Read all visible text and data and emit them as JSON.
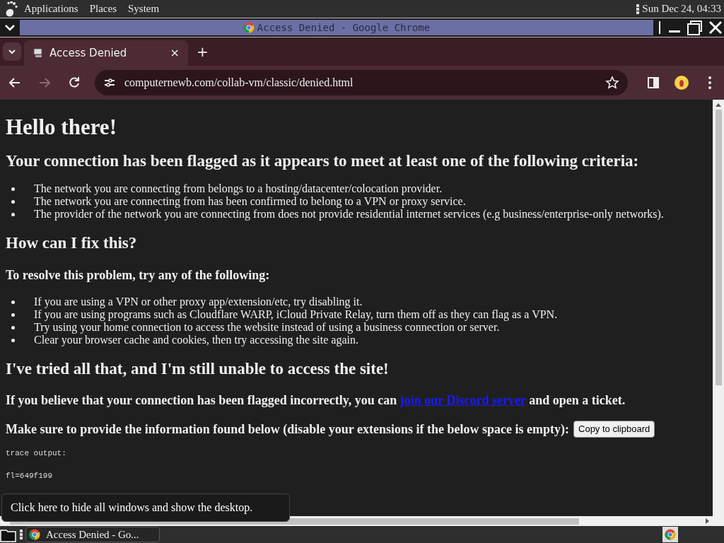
{
  "top_panel": {
    "menus": [
      "Applications",
      "Places",
      "System"
    ],
    "clock": "Sun Dec 24, 04:33"
  },
  "window": {
    "title": "Access Denied - Google Chrome"
  },
  "tabs": [
    {
      "label": "Access Denied",
      "selected": true,
      "close": "×"
    }
  ],
  "new_tab": "+",
  "address": "computernewb.com/collab-vm/classic/denied.html",
  "page": {
    "heading": "Hello there!",
    "criteria_heading": "Your connection has been flagged as it appears to meet at least one of the following criteria:",
    "criteria": [
      "The network you are connecting from belongs to a hosting/datacenter/colocation provider.",
      "The network you are connecting from has been confirmed to belong to a VPN or proxy service.",
      "The provider of the network you are connecting from does not provide residential internet services (e.g business/enterprise-only networks)."
    ],
    "fix_heading": "How can I fix this?",
    "resolve_heading": "To resolve this problem, try any of the following:",
    "fixes": [
      "If you are using a VPN or other proxy app/extension/etc, try disabling it.",
      "If you are using programs such as Cloudflare WARP, iCloud Private Relay, turn them off as they can flag as a VPN.",
      "Try using your home connection to access the website instead of using a business connection or server.",
      "Clear your browser cache and cookies, then try accessing the site again."
    ],
    "tried_heading": "I've tried all that, and I'm still unable to access the site!",
    "flagged_before": "If you believe that your connection has been flagged incorrectly, you can",
    "flagged_link": "join our Discord server",
    "flagged_after": "and open a ticket.",
    "provide_text": "Make sure to provide the information found below (disable your extensions if the below space is empty):",
    "copy_button": "Copy to clipboard",
    "trace": [
      "trace output:",
      "fl=649f199"
    ]
  },
  "tooltip": "Click here to hide all windows and show the desktop.",
  "taskbar": {
    "items": [
      {
        "label": "Access Denied - Go...",
        "selected": false
      }
    ]
  }
}
